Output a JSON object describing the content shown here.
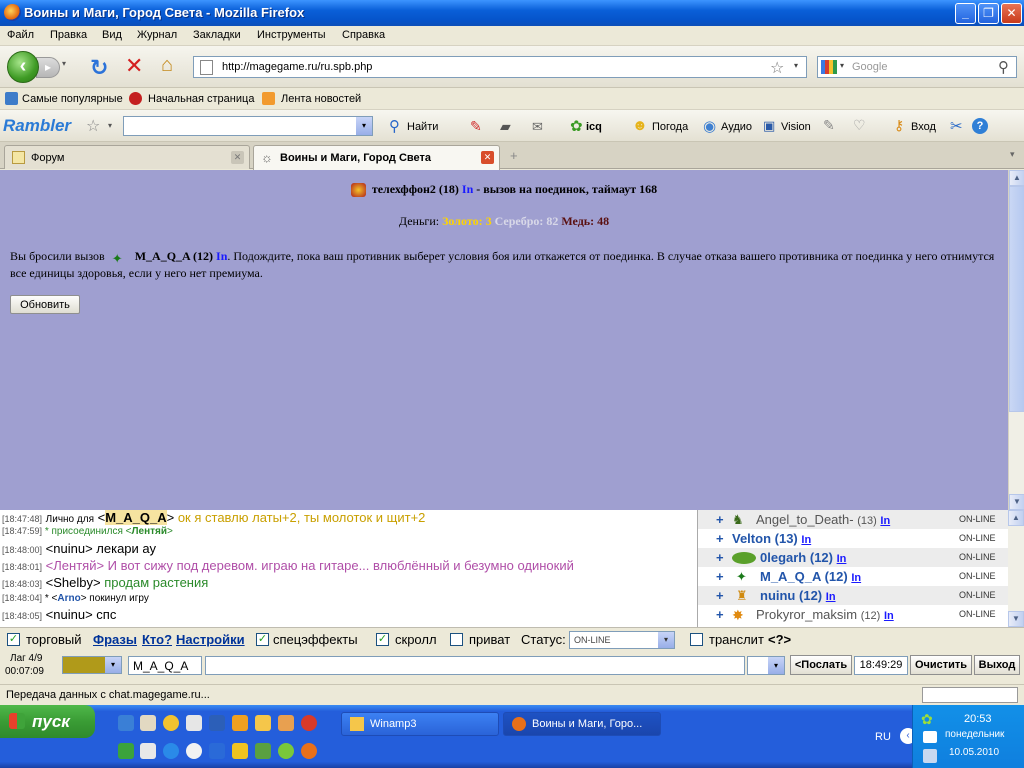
{
  "window": {
    "title": "Воины и Маги, Город Света - Mozilla Firefox"
  },
  "menubar": [
    "Файл",
    "Правка",
    "Вид",
    "Журнал",
    "Закладки",
    "Инструменты",
    "Справка"
  ],
  "nav": {
    "url": "http://magegame.ru/ru.spb.php",
    "search_placeholder": "Google"
  },
  "bookmarks": [
    "Самые популярные",
    "Начальная страница",
    "Лента новостей"
  ],
  "rambler": {
    "logo": "Rambler",
    "buttons": [
      "Найти",
      "icq",
      "Погода",
      "Аудио",
      "Vision",
      "Вход"
    ]
  },
  "tabs": [
    {
      "label": "Форум"
    },
    {
      "label": "Воины и Маги, Город Света"
    }
  ],
  "content": {
    "opponent": "телехффон2 (18)",
    "in_link": "In",
    "duel_text": "- вызов на поединок,   таймаут 168",
    "money_label": "Деньги:",
    "gold": "Золото: 3",
    "silver": "Серебро: 82",
    "copper": "Медь: 48",
    "msg_prefix": "Вы бросили вызов",
    "msg_user": "M_A_Q_A (12)",
    "msg_in": "In",
    "msg_text": ". Подождите, пока ваш противник выберет условия боя или откажется от поединка. В случае отказа вашего противника от поединка у него отнимутся все единицы здоровья, если у него нет премиума.",
    "refresh_label": "Обновить"
  },
  "chat": [
    {
      "time": "[18:47:48]",
      "private": "Лично для",
      "user": "M_A_Q_A",
      "text": " ок я ставлю латы+2, ты молоток и щит+2",
      "color": "#c9a000"
    },
    {
      "time": "[18:47:59]",
      "system": " * присоединился <",
      "user": "Лентяй",
      "tail": ">",
      "color": "#2a8a2a"
    },
    {
      "time": "[18:48:00]",
      "user": "nuinu",
      "text": " лекари ау",
      "color": "#000000"
    },
    {
      "time": "[18:48:01]",
      "user": "Лентяй",
      "text": " И вот сижу под деревом. играю на гитаре... влюблённый и безумно одинокий",
      "color": "#b04fa8"
    },
    {
      "time": "[18:48:03]",
      "user": "Shelby",
      "text": " продам растения",
      "color": "#2a8a2a"
    },
    {
      "time": "[18:48:04]",
      "system": " * <",
      "user": "Arno",
      "tail": "> покинул игру",
      "color": "#2255aa"
    },
    {
      "time": "[18:48:05]",
      "user": "nuinu",
      "text": " спс",
      "color": "#000000"
    }
  ],
  "users": [
    {
      "name": "Angel_to_Death-",
      "level": "(13)",
      "in": "In",
      "status": "ON-LINE"
    },
    {
      "name": "Velton",
      "level": "(13)",
      "in": "In",
      "status": "ON-LINE"
    },
    {
      "name": "0legarh",
      "level": "(12)",
      "in": "In",
      "status": "ON-LINE"
    },
    {
      "name": "M_A_Q_A",
      "level": "(12)",
      "in": "In",
      "status": "ON-LINE"
    },
    {
      "name": "nuinu",
      "level": "(12)",
      "in": "In",
      "status": "ON-LINE"
    },
    {
      "name": "Prokyror_maksim",
      "level": "(12)",
      "in": "In",
      "status": "ON-LINE"
    }
  ],
  "options": {
    "trade": "торговый",
    "phrases": "Фразы",
    "who": "Кто?",
    "settings": "Настройки",
    "effects": "спецэффекты",
    "scroll": "скролл",
    "private": "приват",
    "status_label": "Статус:",
    "status_value": "ON-LINE",
    "translit": "транслит",
    "translit_link": "<?>"
  },
  "inbar": {
    "lag": "Лаг 4/9",
    "timer": "00:07:09",
    "nick": "M_A_Q_A",
    "send": "<Послать",
    "clock": "18:49:29",
    "clear": "Очистить",
    "exit": "Выход"
  },
  "statusbar": {
    "text": "Передача данных с chat.magegame.ru..."
  },
  "taskbar": {
    "start": "пуск",
    "tasks": [
      "Winamp3",
      "Воины и Маги, Горо..."
    ],
    "lang": "RU",
    "time": "20:53",
    "day": "понедельник",
    "date": "10.05.2010"
  }
}
